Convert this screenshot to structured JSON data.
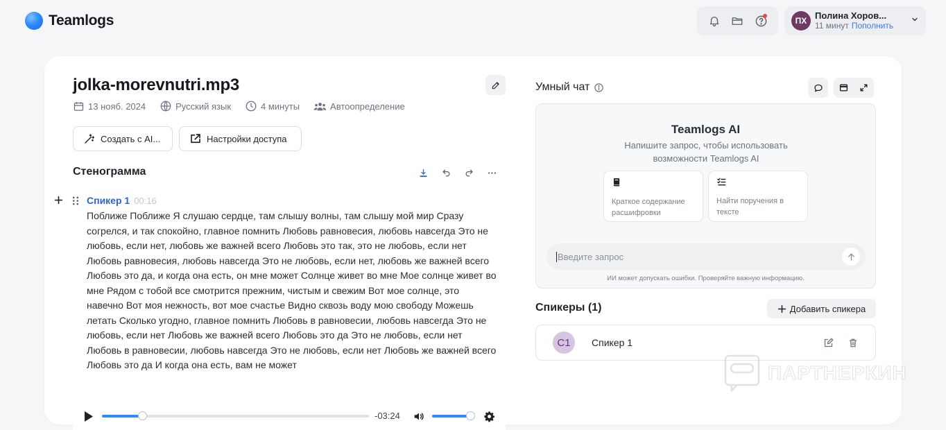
{
  "app": {
    "brand": "Teamlogs"
  },
  "user": {
    "initials": "ПХ",
    "name": "Полина Хоров...",
    "minutes": "11 минут",
    "topup": "Пополнить"
  },
  "file": {
    "title": "jolka-morevnutri.mp3",
    "date": "13 нояб. 2024",
    "language": "Русский язык",
    "duration": "4 минуты",
    "speaker_mode": "Автоопределение"
  },
  "actions": {
    "create_ai": "Создать с AI...",
    "access": "Настройки доступа"
  },
  "transcript": {
    "title": "Стенограмма",
    "segments": [
      {
        "speaker": "Спикер 1",
        "time": "00:16",
        "text": "Поближе Поближе Я слушаю сердце, там слышу волны, там слышу мой мир Сразу согрелся, и так спокойно, главное помнить Любовь равновесия, любовь навсегда Это не любовь, если нет, любовь же важней всего Любовь это так, это не любовь, если нет Любовь равновесия, любовь навсегда Это не любовь, если нет, любовь же важней всего Любовь это да, и когда она есть, он мне может Солнце живет во мне Мое солнце живет во мне Рядом с тобой все смотрится прежним, чистым и свежим Вот мое солнце, это навечно Вот моя нежность, вот мое счастье Видно сквозь воду мою свободу Можешь летать Сколько угодно, главное помнить Любовь в равновесии, любовь навсегда Это не любовь, если нет Любовь же важней всего Любовь это да Это не любовь, если нет Любовь в равновесии, любовь навсегда Это не любовь, если нет Любовь же важней всего Любовь это да И когда она есть, вам не может"
      }
    ]
  },
  "player": {
    "time_remaining": "-03:24",
    "progress": 0.15,
    "volume": 0.9
  },
  "chat": {
    "title": "Умный чат",
    "ai_title": "Teamlogs AI",
    "ai_subtitle": "Напишите запрос, чтобы использовать возможности Teamlogs AI",
    "suggestions": [
      {
        "icon": "book-icon",
        "label": "Краткое содержание расшифровки"
      },
      {
        "icon": "checklist-icon",
        "label": "Найти поручения в тексте"
      }
    ],
    "input_placeholder": "Введите запрос",
    "disclaimer": "ИИ может допускать ошибки. Проверяйте важную информацию."
  },
  "speakers": {
    "title": "Спикеры (1)",
    "add_label": "Добавить спикера",
    "items": [
      {
        "initials": "С1",
        "name": "Спикер 1"
      }
    ]
  },
  "watermark": {
    "text": "ПАРТНЕРКИН"
  },
  "colors": {
    "accent": "#2d8cff",
    "speaker": "#2f63c9",
    "avatar": "#6e3a64"
  }
}
